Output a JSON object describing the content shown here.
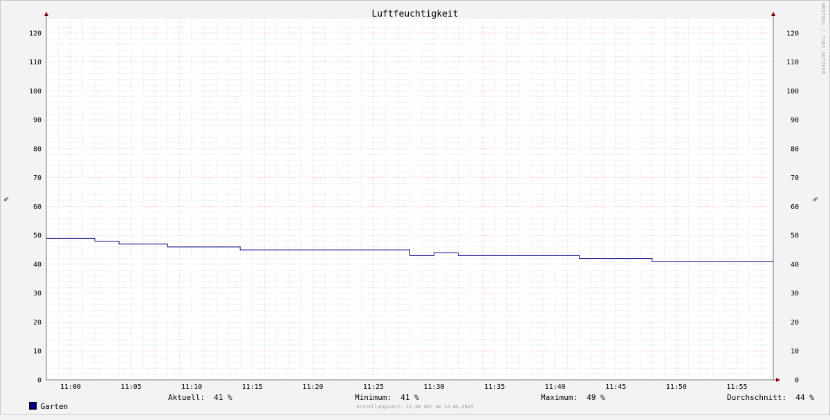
{
  "chart_data": {
    "type": "line",
    "title": "Luftfeuchtigkeit",
    "ylabel": "%",
    "ylim": [
      0,
      125
    ],
    "yticks": [
      0,
      10,
      20,
      30,
      40,
      50,
      60,
      70,
      80,
      90,
      100,
      110,
      120
    ],
    "xlim_minutes": [
      -2,
      58
    ],
    "xticks": [
      "11:00",
      "11:05",
      "11:10",
      "11:15",
      "11:20",
      "11:25",
      "11:30",
      "11:35",
      "11:40",
      "11:45",
      "11:50",
      "11:55"
    ],
    "grid": true,
    "line_style": "step",
    "series": [
      {
        "name": "Garten",
        "color": "#00008b",
        "points": [
          [
            "10:58",
            49
          ],
          [
            "11:02",
            48
          ],
          [
            "11:04",
            47
          ],
          [
            "11:08",
            46
          ],
          [
            "11:14",
            45
          ],
          [
            "11:28",
            43
          ],
          [
            "11:30",
            44
          ],
          [
            "11:32",
            43
          ],
          [
            "11:42",
            42
          ],
          [
            "11:48",
            41
          ],
          [
            "11:58",
            41
          ]
        ]
      }
    ],
    "watermark": "RRDTOOL / TOBI OETIKER",
    "colors": {
      "grid_major": "#e7a0a0",
      "grid_minor": "#c8c8c8",
      "axis_arrow": "#800000",
      "background": "#f3f3f3",
      "plot_background": "#ffffff"
    }
  },
  "legend": {
    "series_name": "Garten",
    "current": "Aktuell:  41 %",
    "minimum": "Minimum:  41 %",
    "maximum": "Maximum:  49 %",
    "average": "Durchschnitt:  44 %"
  },
  "footer": "Erstellungszeit: 11:58 Uhr am 14.06.2025"
}
